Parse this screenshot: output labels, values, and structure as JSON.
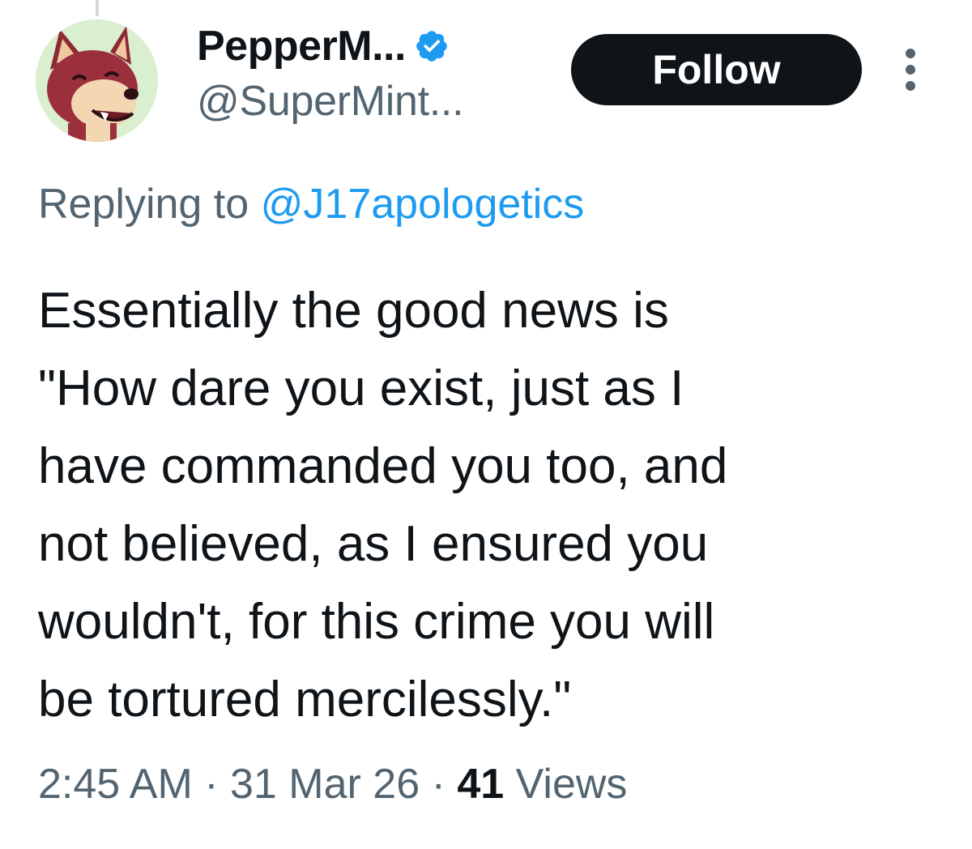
{
  "header": {
    "display_name": "PepperM...",
    "handle": "@SuperMint...",
    "follow_label": "Follow"
  },
  "reply": {
    "prefix": "Replying to ",
    "mention": "@J17apologetics"
  },
  "tweet": {
    "text": "Essentially the good news is\n\"How dare you exist, just as I\nhave commanded you too, and\nnot believed, as I ensured you\nwouldn't, for this crime you will\nbe tortured mercilessly.\""
  },
  "meta": {
    "time": "2:45 AM",
    "separator": " · ",
    "date": "31 Mar 26",
    "views_count": "41",
    "views_label": " Views"
  },
  "colors": {
    "verified": "#1d9bf0",
    "mention": "#1d9bf0",
    "secondary_text": "#536471",
    "follow_button_bg": "#0f1419"
  },
  "icons": {
    "avatar": "fox-avatar",
    "verified": "verified-badge-icon",
    "more": "more-options-icon"
  }
}
